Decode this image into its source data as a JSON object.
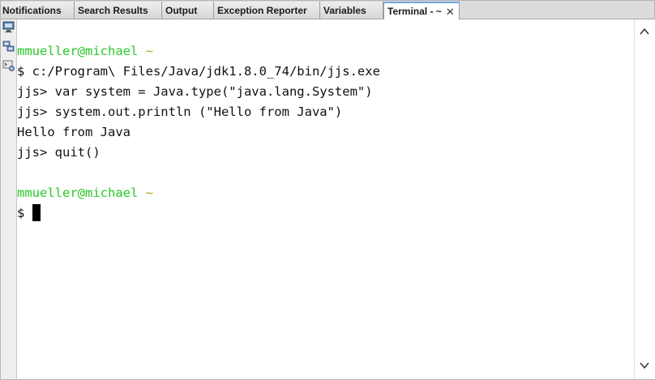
{
  "tabs": [
    {
      "label": "Notifications"
    },
    {
      "label": "Search Results"
    },
    {
      "label": "Output"
    },
    {
      "label": "Exception Reporter"
    },
    {
      "label": "Variables"
    },
    {
      "label": "Terminal - ~",
      "active": true
    }
  ],
  "terminal": {
    "lines": [
      {
        "type": "prompt",
        "user": "mmueller@michael",
        "path": "~"
      },
      {
        "type": "text",
        "text": "$ c:/Program\\ Files/Java/jdk1.8.0_74/bin/jjs.exe"
      },
      {
        "type": "text",
        "text": "jjs> var system = Java.type(\"java.lang.System\")"
      },
      {
        "type": "text",
        "text": "jjs> system.out.println (\"Hello from Java\")"
      },
      {
        "type": "text",
        "text": "Hello from Java"
      },
      {
        "type": "text",
        "text": "jjs> quit()"
      },
      {
        "type": "blank",
        "text": ""
      },
      {
        "type": "prompt",
        "user": "mmueller@michael",
        "path": "~"
      },
      {
        "type": "cursor",
        "text": "$ "
      }
    ]
  },
  "icons": {
    "tool1": "monitor-icon",
    "tool2": "network-icon",
    "tool3": "terminal-settings-icon",
    "scroll_up": "chevron-up-icon",
    "scroll_down": "chevron-down-icon",
    "tab_close": "close-icon"
  },
  "colors": {
    "prompt_user": "#28c828",
    "prompt_path": "#b0a020",
    "active_tab_accent": "#6da9e6"
  }
}
